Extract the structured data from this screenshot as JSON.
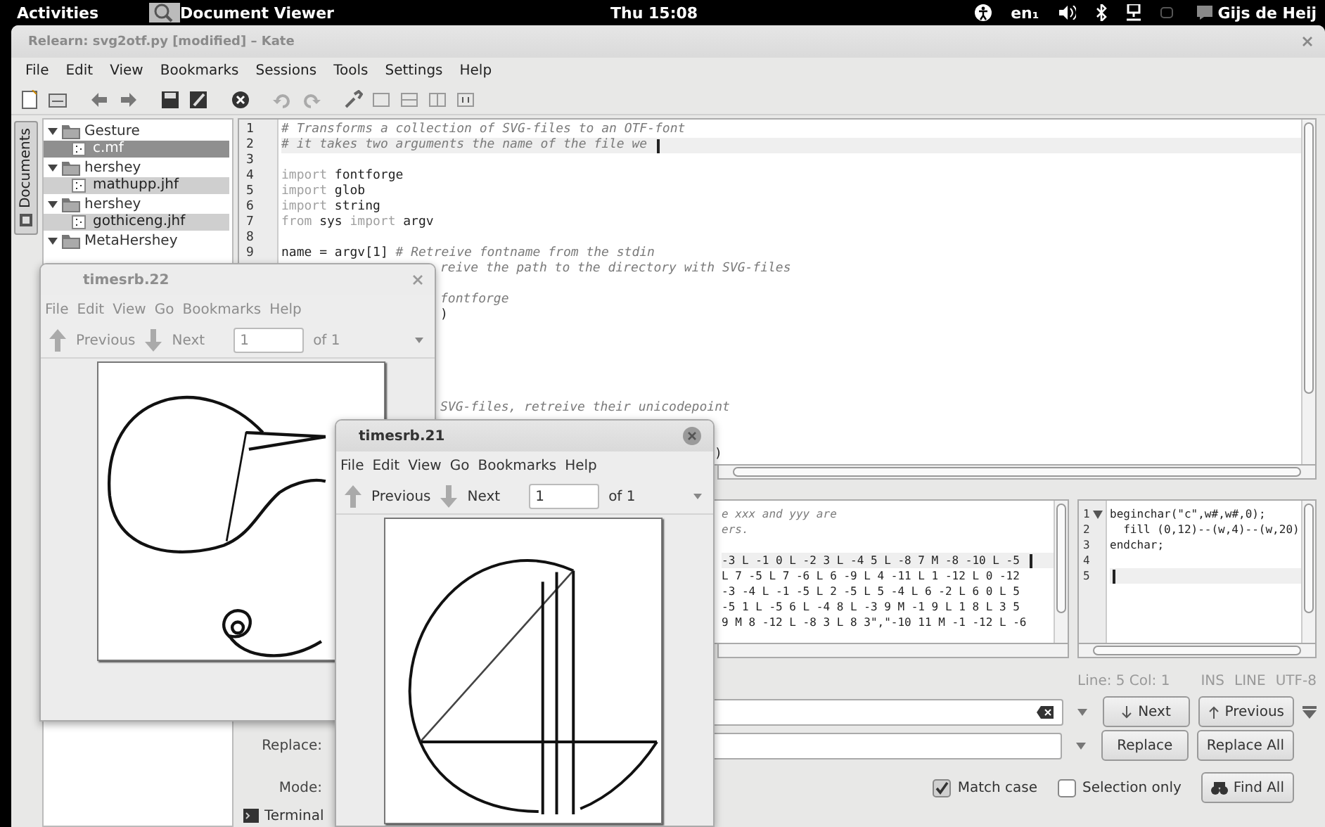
{
  "top_bar": {
    "activities": "Activities",
    "app_name": "Document Viewer",
    "clock": "Thu 15:08",
    "keyboard": "en₁",
    "user": "Gijs de Heij"
  },
  "kate": {
    "title": "Relearn: svg2otf.py [modified] – Kate",
    "menu": [
      "File",
      "Edit",
      "View",
      "Bookmarks",
      "Sessions",
      "Tools",
      "Settings",
      "Help"
    ],
    "side_tab": "Documents",
    "tree": [
      {
        "kind": "folder",
        "label": "Gesture",
        "expanded": true,
        "children": [
          {
            "kind": "file",
            "label": "c.mf",
            "selected": true
          }
        ]
      },
      {
        "kind": "folder",
        "label": "hershey",
        "expanded": true,
        "children": [
          {
            "kind": "file",
            "label": "mathupp.jhf",
            "selected": false
          }
        ]
      },
      {
        "kind": "folder",
        "label": "hershey",
        "expanded": true,
        "children": [
          {
            "kind": "file",
            "label": "gothiceng.jhf",
            "selected": false
          }
        ]
      },
      {
        "kind": "folder",
        "label": "MetaHershey",
        "expanded": true
      }
    ],
    "editor": {
      "line_numbers": [
        "1",
        "2",
        "3",
        "4",
        "5",
        "6",
        "7",
        "8",
        "9"
      ],
      "lines": [
        {
          "kind": "code",
          "current": false,
          "tokens": [
            {
              "kind": "comment",
              "text": "# Transforms a collection of SVG-files to an OTF-font"
            }
          ]
        },
        {
          "kind": "code",
          "current": true,
          "tokens": [
            {
              "kind": "comment",
              "text": "# it takes two arguments the name of the file we"
            }
          ]
        },
        {
          "kind": "blank",
          "current": false
        },
        {
          "kind": "code",
          "current": false,
          "tokens": [
            {
              "kind": "keyword",
              "text": "import"
            },
            {
              "kind": "plain",
              "text": "fontforge"
            }
          ]
        },
        {
          "kind": "code",
          "current": false,
          "tokens": [
            {
              "kind": "keyword",
              "text": "import"
            },
            {
              "kind": "plain",
              "text": "glob"
            }
          ]
        },
        {
          "kind": "code",
          "current": false,
          "tokens": [
            {
              "kind": "keyword",
              "text": "import"
            },
            {
              "kind": "plain",
              "text": "string"
            }
          ]
        },
        {
          "kind": "code",
          "current": false,
          "tokens": [
            {
              "kind": "keyword",
              "text": "from"
            },
            {
              "kind": "plain",
              "text": "sys"
            },
            {
              "kind": "keyword",
              "text": "import"
            },
            {
              "kind": "plain",
              "text": "argv"
            }
          ]
        },
        {
          "kind": "blank",
          "current": false
        },
        {
          "kind": "code",
          "current": false,
          "tokens": [
            {
              "kind": "plain",
              "text": "name = argv[1]"
            },
            {
              "kind": "comment",
              "text": "# Retreive fontname from the stdin"
            }
          ]
        },
        {
          "kind": "cut",
          "current": false,
          "tokens": [
            {
              "kind": "comment",
              "text": "reive the path to the directory with SVG-files"
            }
          ]
        },
        {
          "kind": "blank",
          "current": false
        },
        {
          "kind": "cut",
          "current": false,
          "tokens": [
            {
              "kind": "comment",
              "text": "fontforge"
            }
          ]
        },
        {
          "kind": "cut",
          "current": false,
          "tokens": [
            {
              "kind": "plain",
              "text": ")"
            }
          ]
        },
        {
          "kind": "blank",
          "current": false
        },
        {
          "kind": "blank",
          "current": false
        },
        {
          "kind": "blank",
          "current": false
        },
        {
          "kind": "blank",
          "current": false
        },
        {
          "kind": "blank",
          "current": false
        },
        {
          "kind": "cut",
          "current": false,
          "tokens": [
            {
              "kind": "comment",
              "text": "SVG-files, retreive their unicodepoint"
            }
          ]
        },
        {
          "kind": "blank",
          "current": false
        },
        {
          "kind": "blank",
          "current": false
        },
        {
          "kind": "cut_far",
          "current": false,
          "tokens": [
            {
              "kind": "plain",
              "text": ")"
            }
          ]
        }
      ]
    },
    "split_left": {
      "lines": [
        {
          "kind": "cut",
          "current": false,
          "tokens": [
            {
              "kind": "comment",
              "text": "e xxx and yyy are"
            }
          ]
        },
        {
          "kind": "cut",
          "current": false,
          "tokens": [
            {
              "kind": "comment",
              "text": "ers."
            }
          ]
        },
        {
          "kind": "blank",
          "current": false
        },
        {
          "kind": "cut",
          "current": true,
          "tokens": [
            {
              "kind": "plain",
              "text": "-3 L -1 0 L -2 3 L -4 5 L -8 7 M -8 -10 L -5"
            }
          ]
        },
        {
          "kind": "cut",
          "current": false,
          "tokens": [
            {
              "kind": "plain",
              "text": "L 7 -5 L 7 -6 L 6 -9 L 4 -11 L 1 -12 L 0 -12"
            }
          ]
        },
        {
          "kind": "cut",
          "current": false,
          "tokens": [
            {
              "kind": "plain",
              "text": "-3 -4 L -1 -5 L 2 -5 L 5 -4 L 6 -2 L 6 0 L 5"
            }
          ]
        },
        {
          "kind": "cut",
          "current": false,
          "tokens": [
            {
              "kind": "plain",
              "text": "-5 1 L -5 6 L -4 8 L -3 9 M -1 9 L 1 8 L 3 5"
            }
          ]
        },
        {
          "kind": "cut",
          "current": false,
          "tokens": [
            {
              "kind": "plain",
              "text": "9 M 8 -12 L -8 3 L 8 3\",\"-10 11 M -1 -12 L -6"
            }
          ]
        }
      ]
    },
    "split_right": {
      "line_numbers": [
        "1",
        "2",
        "3",
        "4",
        "5"
      ],
      "lines": [
        {
          "kind": "code",
          "current": false,
          "tokens": [
            {
              "kind": "plain",
              "text": "beginchar(\"c\",w#,w#,0);"
            }
          ]
        },
        {
          "kind": "indented",
          "current": false,
          "tokens": [
            {
              "kind": "plain",
              "text": "fill (0,12)--(w,4)--(w,20)"
            }
          ]
        },
        {
          "kind": "code",
          "current": false,
          "tokens": [
            {
              "kind": "plain",
              "text": "endchar;"
            }
          ]
        },
        {
          "kind": "blank",
          "current": false
        },
        {
          "kind": "blank",
          "current": true
        }
      ]
    },
    "cursor_position": "Line: 5 Col: 1",
    "flags": [
      "INS",
      "LINE",
      "UTF-8"
    ],
    "find": {
      "next": "Next",
      "previous": "Previous"
    },
    "replace": {
      "label": "Replace:",
      "replace": "Replace",
      "replace_all": "Replace All"
    },
    "mode": {
      "label": "Mode:",
      "options": [
        {
          "label": "Match case",
          "checked": true
        },
        {
          "label": "Selection only",
          "checked": false
        }
      ],
      "find_all": "Find All"
    },
    "terminal": "Terminal"
  },
  "viewers": [
    {
      "title": "timesrb.22",
      "active": false,
      "menu": [
        "File",
        "Edit",
        "View",
        "Go",
        "Bookmarks",
        "Help"
      ],
      "previous": "Previous",
      "next": "Next",
      "page": "1",
      "page_count": "of 1"
    },
    {
      "title": "timesrb.21",
      "active": true,
      "menu": [
        "File",
        "Edit",
        "View",
        "Go",
        "Bookmarks",
        "Help"
      ],
      "previous": "Previous",
      "next": "Next",
      "page": "1",
      "page_count": "of 1"
    }
  ]
}
